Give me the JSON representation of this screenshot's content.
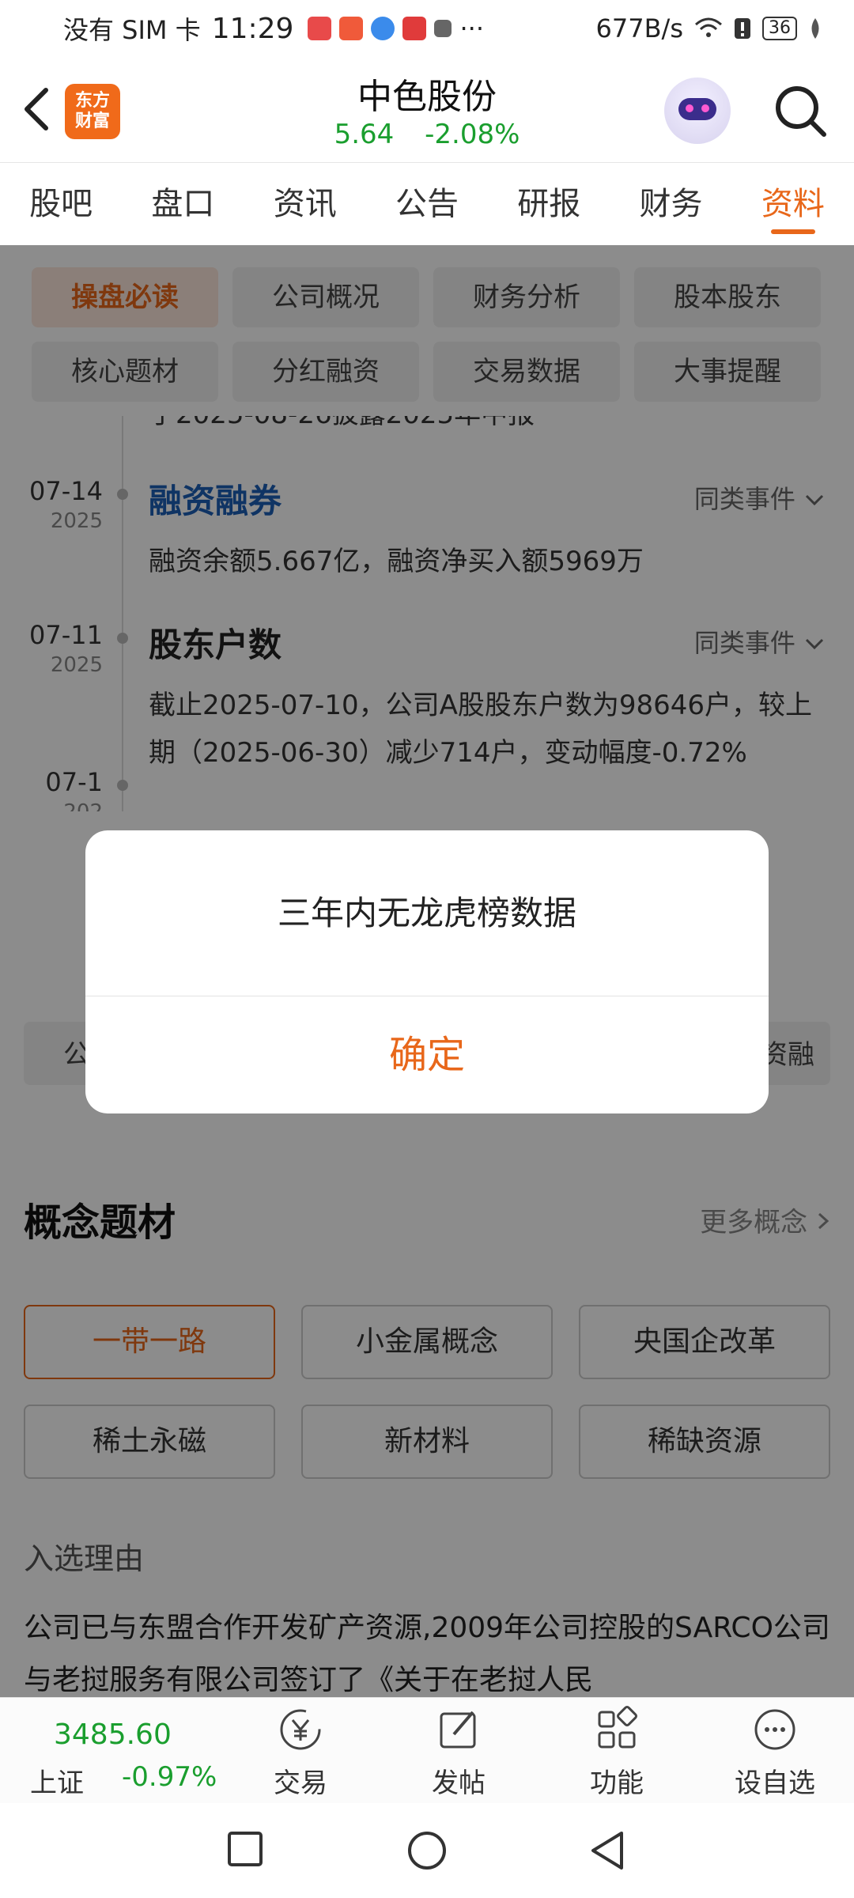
{
  "status_bar": {
    "carrier": "没有 SIM 卡",
    "time": "11:29",
    "dots": "···",
    "net_speed": "677B/s",
    "battery": "36"
  },
  "header": {
    "logo_line1": "东方",
    "logo_line2": "财富",
    "stock_name": "中色股份",
    "price": "5.64",
    "change_pct": "-2.08%"
  },
  "tabs": [
    "股吧",
    "盘口",
    "资讯",
    "公告",
    "研报",
    "财务",
    "资料"
  ],
  "subnav": [
    "操盘必读",
    "公司概况",
    "财务分析",
    "股本股东",
    "核心题材",
    "分红融资",
    "交易数据",
    "大事提醒"
  ],
  "timeline": {
    "partial_text": "于2025-08-26披露2025年中报",
    "items": [
      {
        "date": "07-14",
        "year": "2025",
        "title": "融资融券",
        "more": "同类事件",
        "desc": "融资余额5.667亿，融资净买入额5969万"
      },
      {
        "date": "07-11",
        "year": "2025",
        "title": "股东户数",
        "more": "同类事件",
        "desc": "截止2025-07-10，公司A股股东户数为98646户，较上期（2025-06-30）减少714户，变动幅度-0.72%"
      },
      {
        "date": "07-1",
        "year": "202"
      }
    ]
  },
  "pill_row": {
    "left": "公",
    "right": "资融"
  },
  "concepts": {
    "title": "概念题材",
    "more": "更多概念",
    "tags": [
      "一带一路",
      "小金属概念",
      "央国企改革",
      "稀土永磁",
      "新材料",
      "稀缺资源"
    ],
    "reason_title": "入选理由",
    "reason_text": "公司已与东盟合作开发矿产资源,2009年公司控股的SARCO公司与老挝服务有限公司签订了《关于在老挝人民"
  },
  "dialog": {
    "message": "三年内无龙虎榜数据",
    "ok_label": "确定"
  },
  "bottom_bar": {
    "index_value": "3485.60",
    "index_name": "上证",
    "index_change": "-0.97%",
    "buttons": [
      "交易",
      "发帖",
      "功能",
      "设自选"
    ]
  },
  "colors": {
    "accent": "#e8671a",
    "down": "#1a9e2e",
    "link": "#1d5fb7"
  }
}
